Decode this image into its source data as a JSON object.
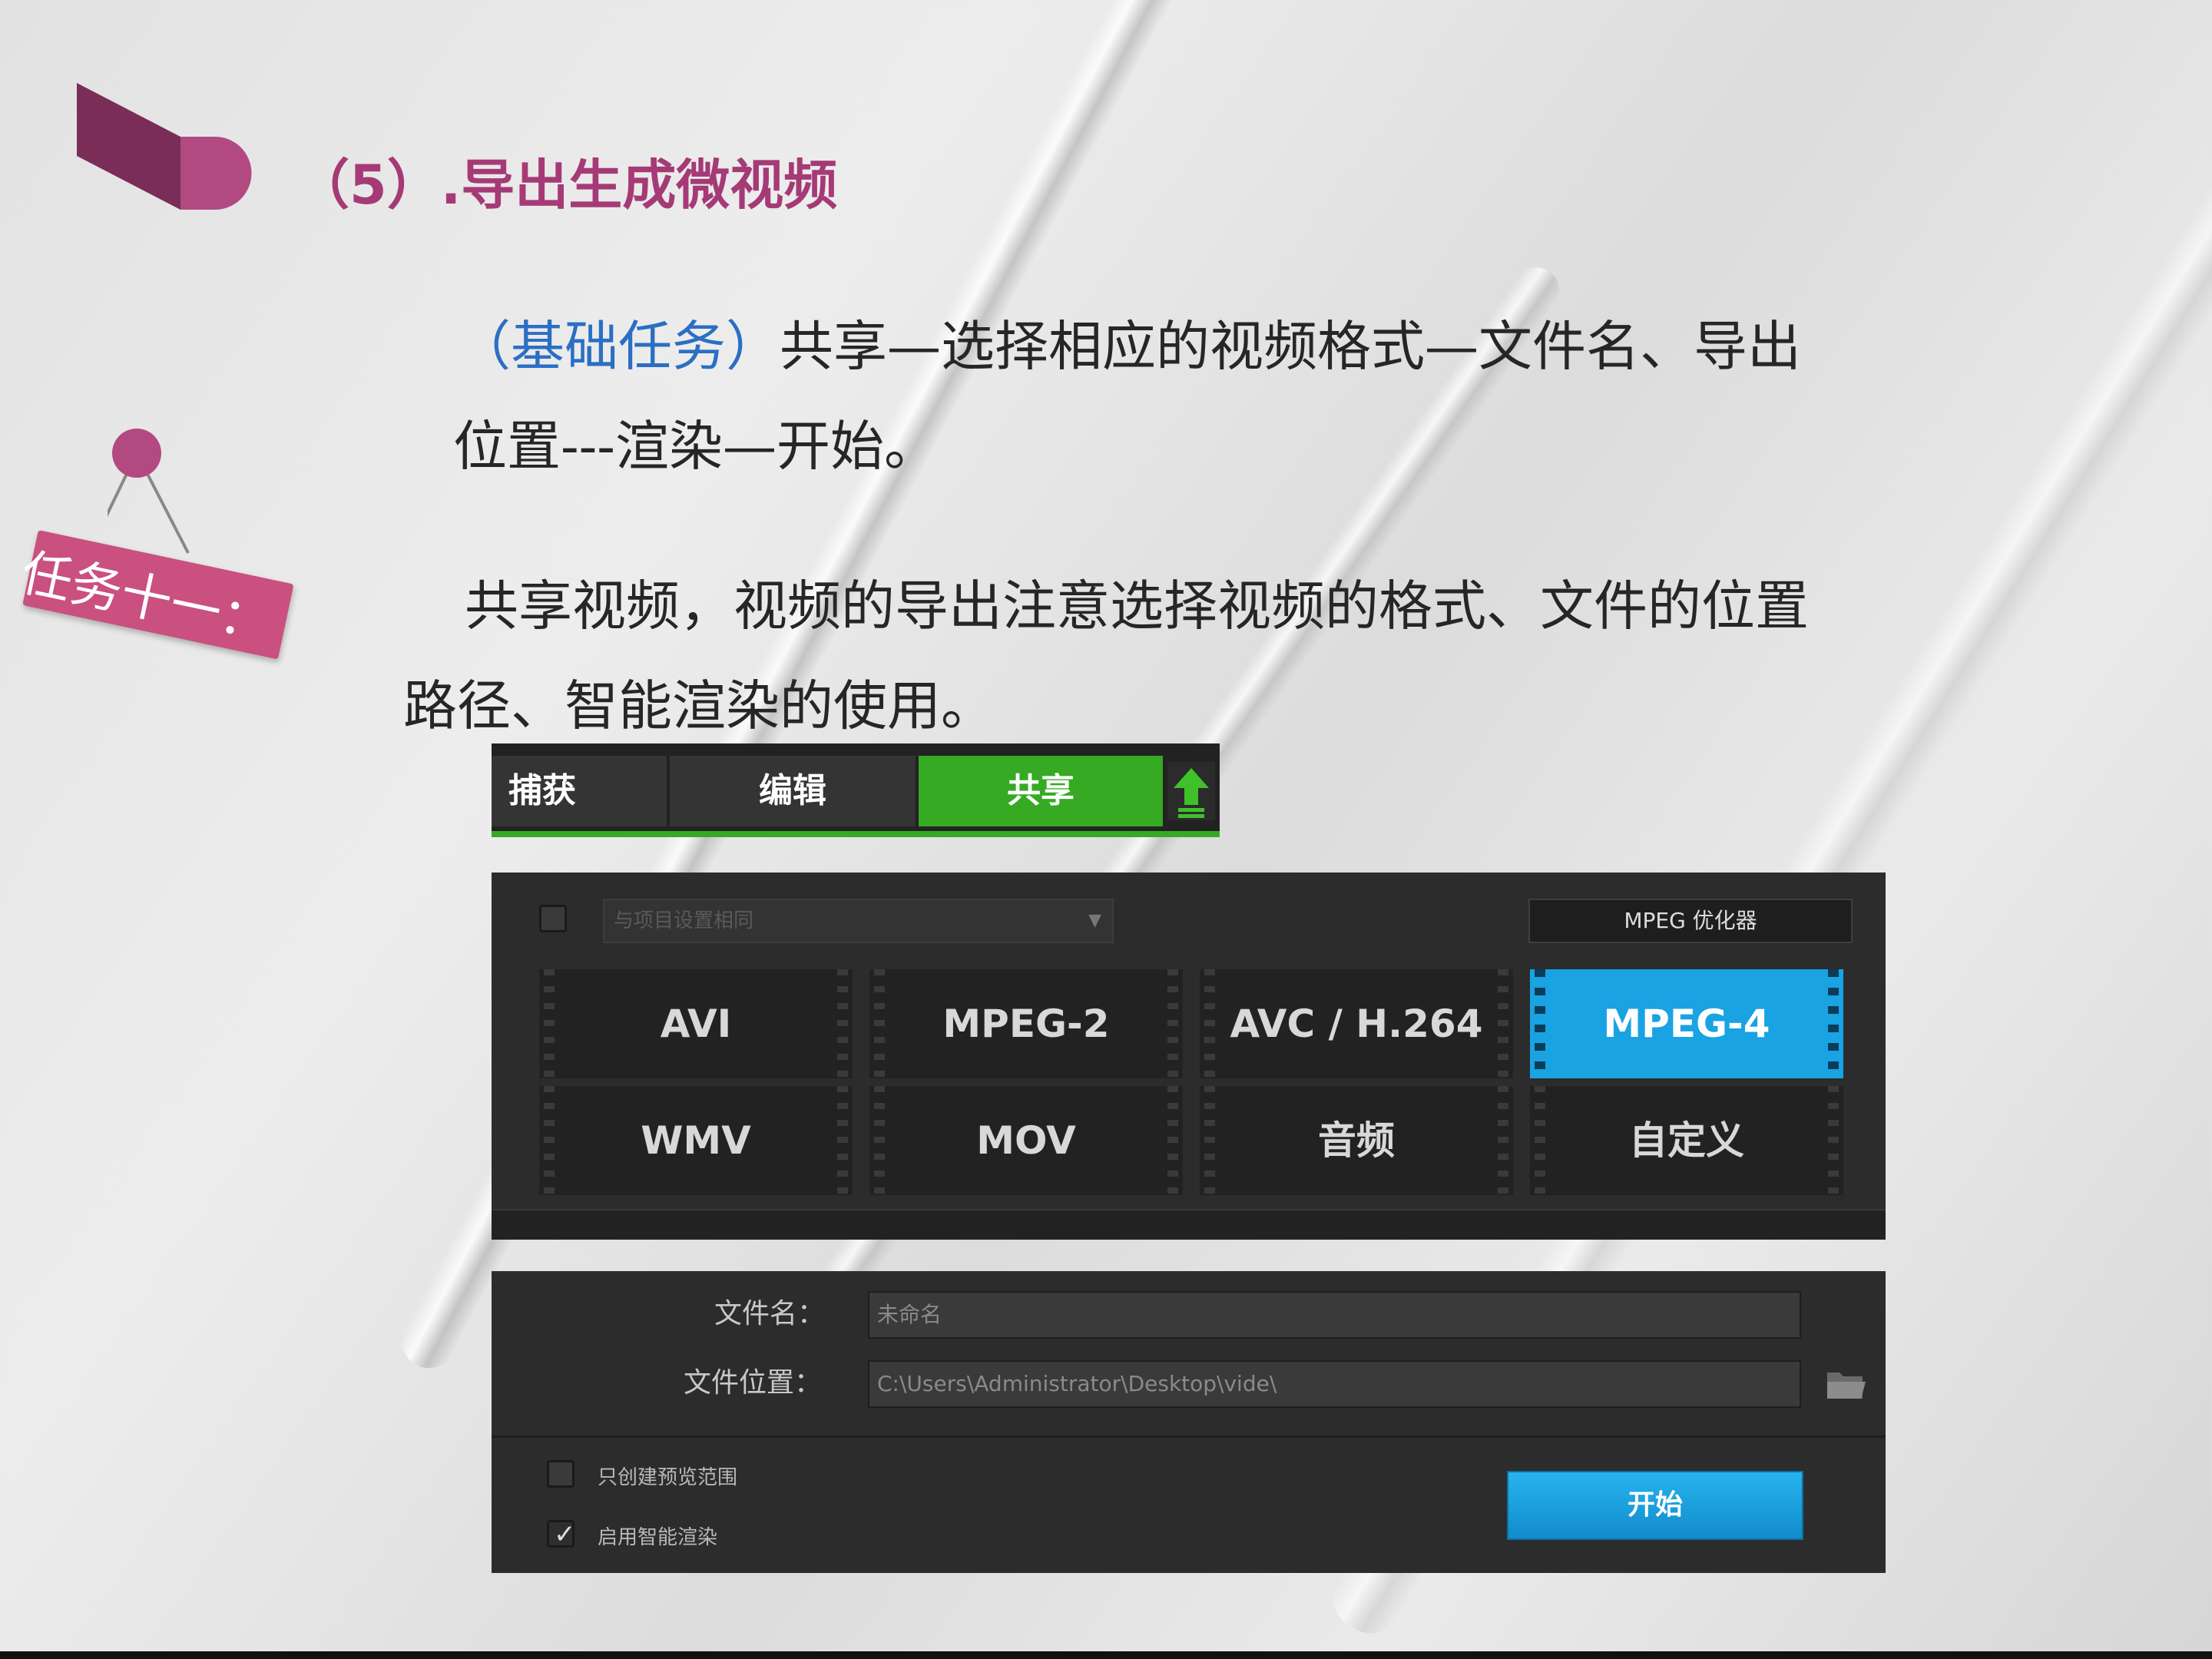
{
  "slide": {
    "title": "（5）.导出生成微视频",
    "tag_label": "任务十一：",
    "para1_highlight": "（基础任务）",
    "para1_rest": "共享—选择相应的视频格式—文件名、导出",
    "para1_line2": "位置---渲染—开始。",
    "para2_line1": "共享视频，视频的导出注意选择视频的格式、文件的位置",
    "para2_line2": "路径、智能渲染的使用。"
  },
  "nav": {
    "tabs": [
      "捕获",
      "编辑",
      "共享"
    ],
    "active_tab": "共享"
  },
  "formats": {
    "profile_placeholder": "与项目设置相同",
    "optimizer_label": "MPEG 优化器",
    "items": [
      "AVI",
      "MPEG-2",
      "AVC / H.264",
      "MPEG-4",
      "WMV",
      "MOV",
      "音频",
      "自定义"
    ],
    "selected": "MPEG-4"
  },
  "output": {
    "filename_label": "文件名：",
    "filename_value": "未命名",
    "location_label": "文件位置：",
    "location_value": "C:\\Users\\Administrator\\Desktop\\vide\\",
    "preview_only_label": "只创建预览范围",
    "preview_only_checked": false,
    "smart_render_label": "启用智能渲染",
    "smart_render_checked": true,
    "start_button": "开始"
  },
  "colors": {
    "title": "#a53a76",
    "tag": "#c9507f",
    "highlight": "#2a6fc4",
    "active_tab": "#35aa22",
    "selected_format": "#19a3e3"
  }
}
